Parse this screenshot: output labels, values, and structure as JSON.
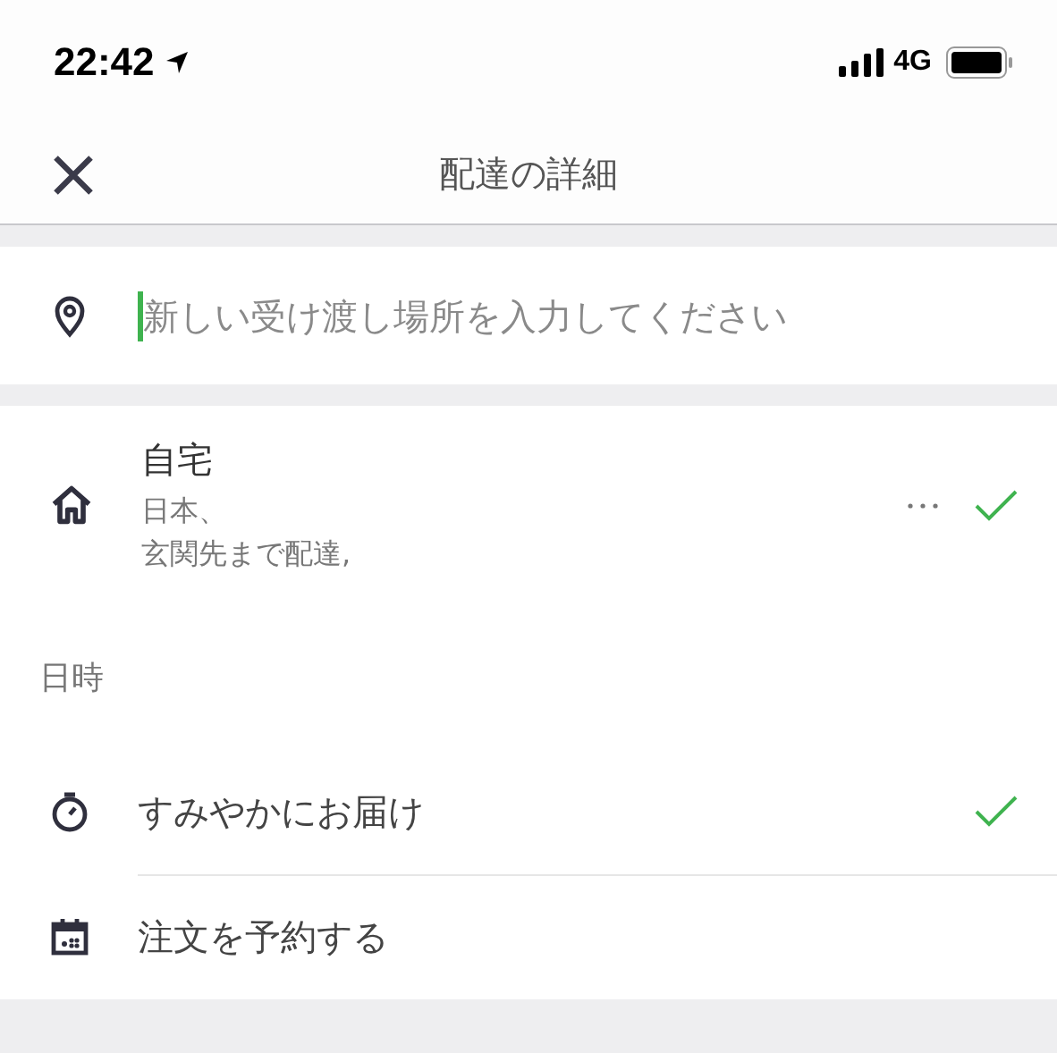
{
  "status_bar": {
    "time": "22:42",
    "network": "4G"
  },
  "header": {
    "title": "配達の詳細"
  },
  "search": {
    "placeholder": "新しい受け渡し場所を入力してください"
  },
  "address": {
    "name": "自宅",
    "lines": [
      "日本、",
      "玄関先まで配達,"
    ],
    "selected": true
  },
  "section_label": "日時",
  "options": [
    {
      "kind": "asap",
      "label": "すみやかにお届け",
      "selected": true
    },
    {
      "kind": "schedule",
      "label": "注文を予約する",
      "selected": false
    }
  ]
}
